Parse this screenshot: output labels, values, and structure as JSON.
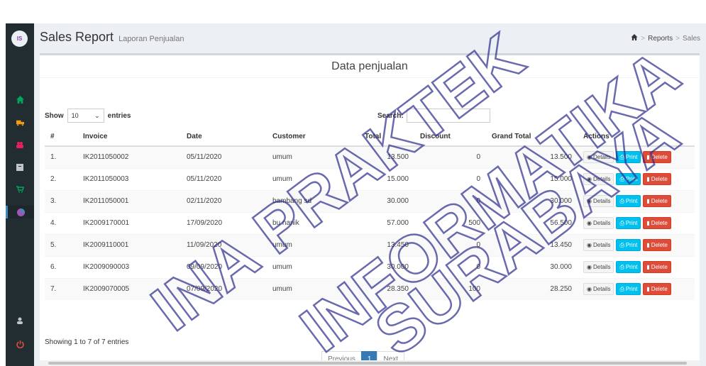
{
  "header": {
    "title": "Sales Report",
    "subtitle": "Laporan Penjualan"
  },
  "breadcrumb": {
    "reports": "Reports",
    "sales": "Sales"
  },
  "box": {
    "title": "Data penjualan"
  },
  "table_controls": {
    "show_label": "Show",
    "entries_value": "10",
    "entries_label": "entries",
    "search_label": "Search:"
  },
  "table": {
    "headers": [
      "#",
      "Invoice",
      "Date",
      "Customer",
      "Total",
      "Discount",
      "Grand Total",
      "Actions"
    ],
    "rows": [
      [
        "1.",
        "IK2011050002",
        "05/11/2020",
        "umum",
        "13.500",
        "0",
        "13.500"
      ],
      [
        "2.",
        "IK2011050003",
        "05/11/2020",
        "umum",
        "15.000",
        "0",
        "15.000"
      ],
      [
        "3.",
        "IK2011050001",
        "02/11/2020",
        "bambang sd",
        "30.000",
        "0",
        "30.000"
      ],
      [
        "4.",
        "IK2009170001",
        "17/09/2020",
        "bu nanik",
        "57.000",
        "500",
        "56.500"
      ],
      [
        "5.",
        "IK2009110001",
        "11/09/2020",
        "umum",
        "13.450",
        "0",
        "13.450"
      ],
      [
        "6.",
        "IK2009090003",
        "09/09/2020",
        "umum",
        "30.000",
        "0",
        "30.000"
      ],
      [
        "7.",
        "IK2009070005",
        "07/09/2020",
        "umum",
        "28.350",
        "100",
        "28.250"
      ]
    ],
    "actions": {
      "details": "Details",
      "print": "Print",
      "delete": "Delete"
    }
  },
  "footer": {
    "info": "Showing 1 to 7 of 7 entries",
    "previous": "Previous",
    "page": "1",
    "next": "Next"
  },
  "watermark": {
    "lines": [
      "INA PRAKTEK",
      "INFORMATIKA",
      "SURABAYA"
    ]
  },
  "colors": {
    "sidebar": "#222d32",
    "primary": "#337ab7",
    "info": "#00c0ef",
    "danger": "#dd4b39",
    "watermark": "#2b2b8c"
  }
}
